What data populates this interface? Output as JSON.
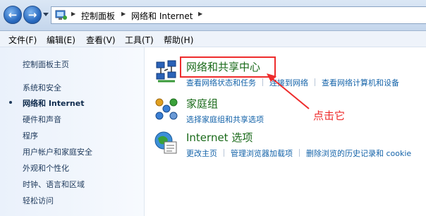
{
  "breadcrumb": {
    "items": [
      "控制面板",
      "网络和 Internet"
    ]
  },
  "menu": [
    "文件(F)",
    "编辑(E)",
    "查看(V)",
    "工具(T)",
    "帮助(H)"
  ],
  "sidebar": {
    "home": "控制面板主页",
    "items": [
      "系统和安全",
      "网络和 Internet",
      "硬件和声音",
      "程序",
      "用户帐户和家庭安全",
      "外观和个性化",
      "时钟、语言和区域",
      "轻松访问"
    ]
  },
  "categories": [
    {
      "title": "网络和共享中心",
      "links": [
        "查看网络状态和任务",
        "连接到网络",
        "查看网络计算机和设备"
      ]
    },
    {
      "title": "家庭组",
      "links": [
        "选择家庭组和共享选项"
      ]
    },
    {
      "title": "Internet 选项",
      "links": [
        "更改主页",
        "管理浏览器加载项",
        "删除浏览的历史记录和 cookie"
      ]
    }
  ],
  "annotation": {
    "text": "点击它",
    "color": "#ee2c2c"
  },
  "colors": {
    "title": "#1a6a1a",
    "link": "#1463a9"
  }
}
